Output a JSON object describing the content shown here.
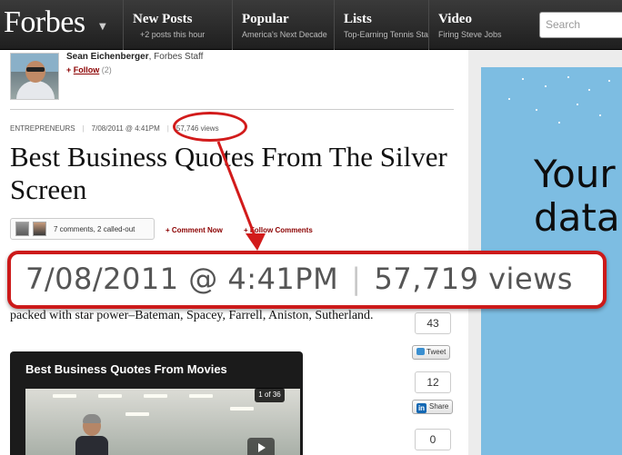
{
  "header": {
    "logo": "Forbes",
    "nav": [
      {
        "title": "New Posts",
        "subtitle": "+2 posts this hour"
      },
      {
        "title": "Popular",
        "subtitle": "America's Next Decade"
      },
      {
        "title": "Lists",
        "subtitle": "Top-Earning Tennis Stars"
      },
      {
        "title": "Video",
        "subtitle": "Firing Steve Jobs"
      }
    ],
    "search_placeholder": "Search"
  },
  "author": {
    "name": "Sean Eichenberger",
    "role": ", Forbes Staff",
    "follow_label": "Follow",
    "follow_count": "(2)"
  },
  "article": {
    "category": "ENTREPRENEURS",
    "timestamp": "7/08/2011 @ 4:41PM",
    "views": "57,746 views",
    "title": "Best Business Quotes From The Silver Screen",
    "comments_summary": "7 comments, 2 called-out",
    "comment_now": "+ Comment Now",
    "follow_comments": "+ Follow Comments",
    "body": "packed with star power–Bateman, Spacey, Farrell, Aniston, Sutherland."
  },
  "callout": {
    "timestamp": "7/08/2011 @ 4:41PM",
    "separator": "|",
    "views": "57,719 views"
  },
  "share": {
    "tweet_count": "43",
    "tweet_label": "Tweet",
    "linkedin_count": "12",
    "linkedin_label": "Share",
    "third_count": "0"
  },
  "gallery": {
    "title": "Best Business Quotes From Movies",
    "counter": "1 of 36"
  },
  "ad": {
    "line1": "Your",
    "line2": "data"
  },
  "colors": {
    "nav_bg": "#2a2a2a",
    "accent_red": "#8b0000",
    "annotation_red": "#d21b1b",
    "ad_blue": "#7dbde2"
  }
}
